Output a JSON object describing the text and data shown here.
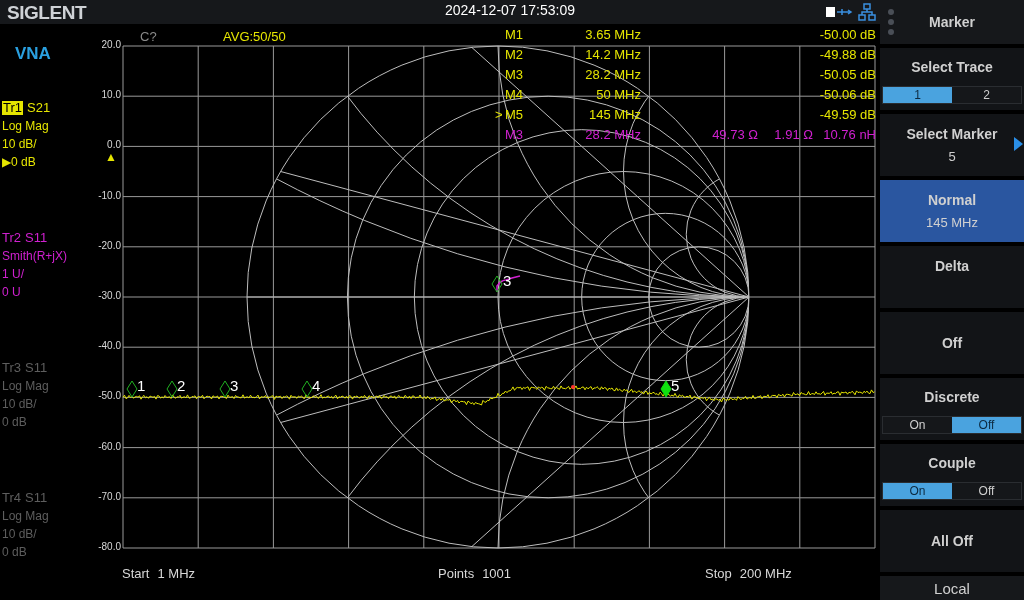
{
  "header": {
    "logo": "SIGLENT",
    "datetime": "2024-12-07 17:53:09"
  },
  "mode": "VNA",
  "traces": [
    {
      "id": "Tr1",
      "param": "S21",
      "format": "Log Mag",
      "scale": "10 dB/",
      "ref": "▶0 dB",
      "color": "#e6e600",
      "selected": true
    },
    {
      "id": "Tr2",
      "param": "S11",
      "format": "Smith(R+jX)",
      "scale": "1 U/",
      "ref": "0 U",
      "color": "#d020d0",
      "selected": false
    },
    {
      "id": "Tr3",
      "param": "S11",
      "format": "Log Mag",
      "scale": "10 dB/",
      "ref": "0 dB",
      "color": "#5e5e5e",
      "selected": false
    },
    {
      "id": "Tr4",
      "param": "S11",
      "format": "Log Mag",
      "scale": "10 dB/",
      "ref": "0 dB",
      "color": "#5e5e5e",
      "selected": false
    }
  ],
  "status": {
    "cal": "C?",
    "avg": "AVG:50/50"
  },
  "marker_table": [
    {
      "name": "M1",
      "freq": "3.65 MHz",
      "values": [
        "-50.00 dB"
      ],
      "color": "#e6e600"
    },
    {
      "name": "M2",
      "freq": "14.2 MHz",
      "values": [
        "-49.88 dB"
      ],
      "color": "#e6e600"
    },
    {
      "name": "M3",
      "freq": "28.2 MHz",
      "values": [
        "-50.05 dB"
      ],
      "color": "#e6e600"
    },
    {
      "name": "M4",
      "freq": "50 MHz",
      "values": [
        "-50.06 dB"
      ],
      "color": "#e6e600"
    },
    {
      "pointer": ">",
      "name": "M5",
      "freq": "145 MHz",
      "values": [
        "-49.59 dB"
      ],
      "color": "#e6e600"
    },
    {
      "name": "M3",
      "freq": "28.2 MHz",
      "values": [
        "49.73 Ω",
        "1.91 Ω",
        "10.76 nH"
      ],
      "color": "#d020d0"
    }
  ],
  "chart": {
    "yticks": [
      "20.0",
      "10.0",
      "0.0",
      "-10.0",
      "-20.0",
      "-30.0",
      "-40.0",
      "-50.0",
      "-60.0",
      "-70.0",
      "-80.0"
    ],
    "ref_marker": "▲",
    "markers": [
      {
        "label": "1",
        "selected": false
      },
      {
        "label": "2",
        "selected": false
      },
      {
        "label": "3",
        "selected": false
      },
      {
        "label": "4",
        "selected": false
      },
      {
        "label": "5",
        "selected": true
      }
    ],
    "smith_marker": {
      "label": "3"
    },
    "footer": [
      {
        "label": "Start",
        "value": "1 MHz"
      },
      {
        "label": "Points",
        "value": "1001"
      },
      {
        "label": "Stop",
        "value": "200 MHz"
      }
    ]
  },
  "menu": {
    "title": "Marker",
    "items": [
      {
        "kind": "toggle",
        "label": "Select Trace",
        "options": [
          {
            "label": "1",
            "selected": true
          },
          {
            "label": "2",
            "selected": false
          }
        ]
      },
      {
        "kind": "button",
        "label": "Select Marker",
        "value": "5",
        "selected": false,
        "submenu": true
      },
      {
        "kind": "button",
        "label": "Normal",
        "value": "145 MHz",
        "selected": true,
        "submenu": false
      },
      {
        "kind": "button",
        "label": "Delta",
        "selected": false,
        "submenu": false
      },
      {
        "kind": "center",
        "label": "Off"
      },
      {
        "kind": "toggle",
        "label": "Discrete",
        "options": [
          {
            "label": "On",
            "selected": false
          },
          {
            "label": "Off",
            "selected": true
          }
        ]
      },
      {
        "kind": "toggle",
        "label": "Couple",
        "options": [
          {
            "label": "On",
            "selected": true
          },
          {
            "label": "Off",
            "selected": false
          }
        ]
      },
      {
        "kind": "center",
        "label": "All Off"
      }
    ],
    "footer": "Local"
  }
}
